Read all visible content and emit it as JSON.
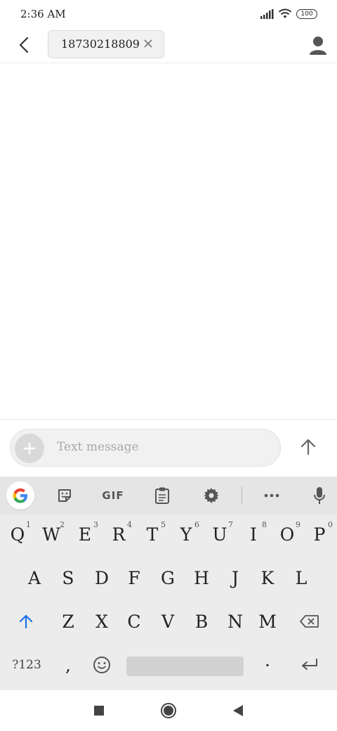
{
  "status_bar": {
    "time": "2:36 AM",
    "battery": "100",
    "icons": [
      "signal-icon",
      "wifi-icon",
      "battery-icon"
    ]
  },
  "header": {
    "back_icon": "back-arrow-icon",
    "recipient": "18730218809",
    "chip_close_icon": "close-icon",
    "contact_icon": "person-icon"
  },
  "compose": {
    "add_icon": "plus-icon",
    "placeholder": "Text message",
    "send_icon": "send-arrow-icon"
  },
  "keyboard": {
    "toolbar": [
      "google-icon",
      "sticker-icon",
      "GIF",
      "clipboard-icon",
      "gear-icon",
      "more-icon",
      "mic-icon"
    ],
    "gif_label": "GIF",
    "row1": [
      {
        "k": "Q",
        "h": "1"
      },
      {
        "k": "W",
        "h": "2"
      },
      {
        "k": "E",
        "h": "3"
      },
      {
        "k": "R",
        "h": "4"
      },
      {
        "k": "T",
        "h": "5"
      },
      {
        "k": "Y",
        "h": "6"
      },
      {
        "k": "U",
        "h": "7"
      },
      {
        "k": "I",
        "h": "8"
      },
      {
        "k": "O",
        "h": "9"
      },
      {
        "k": "P",
        "h": "0"
      }
    ],
    "row2": [
      "A",
      "S",
      "D",
      "F",
      "G",
      "H",
      "J",
      "K",
      "L"
    ],
    "row3": [
      "Z",
      "X",
      "C",
      "V",
      "B",
      "N",
      "M"
    ],
    "symbols_label": "?123",
    "comma": ",",
    "period": "·",
    "shift_icon": "shift-arrow-icon",
    "backspace_icon": "backspace-icon",
    "emoji_icon": "emoji-icon",
    "enter_icon": "enter-icon"
  },
  "nav_bar": {
    "icons": [
      "recents-square-icon",
      "home-circle-icon",
      "back-triangle-icon"
    ]
  },
  "colors": {
    "accent": "#1a73e8",
    "keyboard_bg": "#ececec",
    "chip_bg": "#f1f1f1"
  }
}
